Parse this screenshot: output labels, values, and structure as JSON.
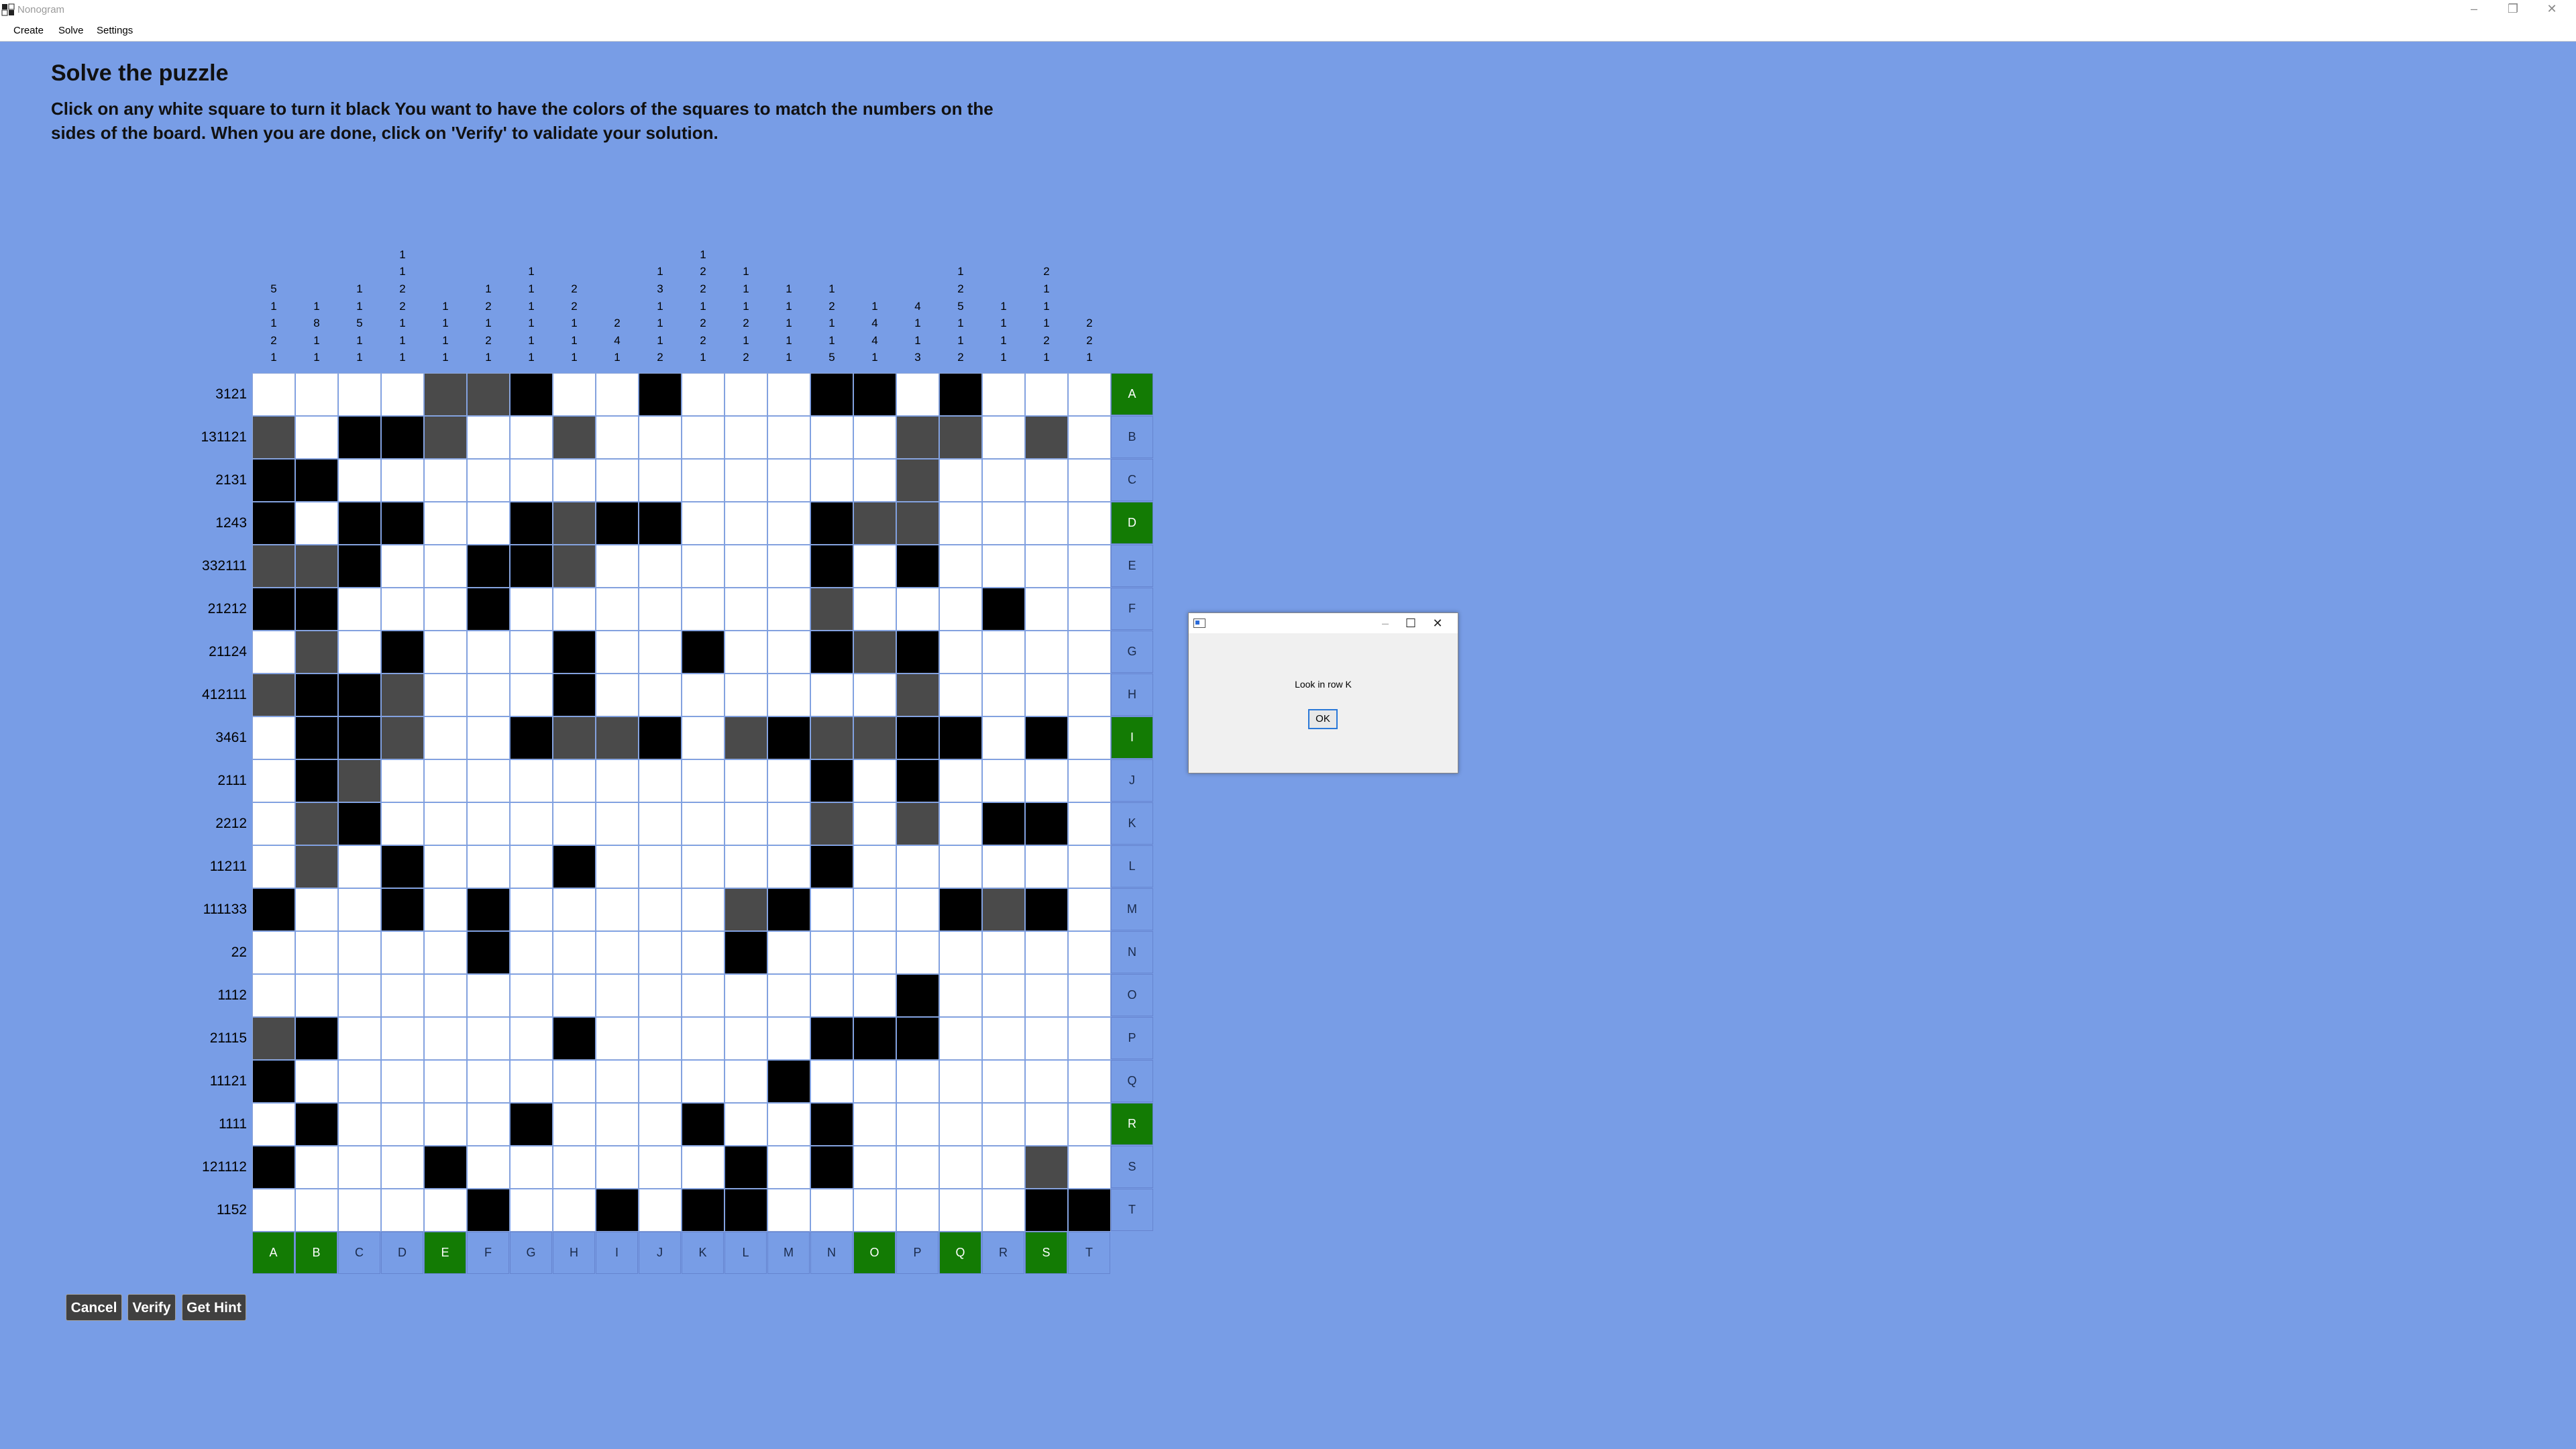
{
  "window": {
    "title": "Nonogram",
    "minimize_glyph": "–",
    "restore_glyph": "❐",
    "close_glyph": "✕"
  },
  "menu": [
    "Create",
    "Solve",
    "Settings"
  ],
  "heading": "Solve the puzzle",
  "instructions": "Click on any white square to turn it black You want to have the colors of the squares to match the numbers on the sides of the board. When you are done, click on 'Verify' to validate your solution.",
  "column_clues": [
    [
      "5",
      "1",
      "1",
      "2",
      "1"
    ],
    [
      "1",
      "8",
      "1",
      "1"
    ],
    [
      "1",
      "1",
      "5",
      "1",
      "1"
    ],
    [
      "1",
      "1",
      "2",
      "2",
      "1",
      "1",
      "1"
    ],
    [
      "1",
      "1",
      "1",
      "1"
    ],
    [
      "1",
      "2",
      "1",
      "2",
      "1"
    ],
    [
      "1",
      "1",
      "1",
      "1",
      "1",
      "1"
    ],
    [
      "2",
      "2",
      "1",
      "1",
      "1"
    ],
    [
      "2",
      "4",
      "1"
    ],
    [
      "1",
      "3",
      "1",
      "1",
      "1",
      "2"
    ],
    [
      "1",
      "2",
      "2",
      "1",
      "2",
      "2",
      "1"
    ],
    [
      "1",
      "1",
      "1",
      "2",
      "1",
      "2"
    ],
    [
      "1",
      "1",
      "1",
      "1",
      "1"
    ],
    [
      "1",
      "2",
      "1",
      "1",
      "5"
    ],
    [
      "1",
      "4",
      "4",
      "1"
    ],
    [
      "4",
      "1",
      "1",
      "3"
    ],
    [
      "1",
      "2",
      "5",
      "1",
      "1",
      "2"
    ],
    [
      "1",
      "1",
      "1",
      "1"
    ],
    [
      "2",
      "1",
      "1",
      "1",
      "2",
      "1"
    ],
    [
      "2",
      "2",
      "1"
    ]
  ],
  "row_clues": [
    "3121",
    "131121",
    "2131",
    "1243",
    "332111",
    "21212",
    "21124",
    "412111",
    "3461",
    "2111",
    "2212",
    "11211",
    "111133",
    "22",
    "1112",
    "21115",
    "11121",
    "1111",
    "121112",
    "1152"
  ],
  "letters": [
    "A",
    "B",
    "C",
    "D",
    "E",
    "F",
    "G",
    "H",
    "I",
    "J",
    "K",
    "L",
    "M",
    "N",
    "O",
    "P",
    "Q",
    "R",
    "S",
    "T"
  ],
  "highlighted_rows": [
    "A",
    "D",
    "I",
    "R"
  ],
  "highlighted_columns": [
    "A",
    "B",
    "E",
    "O",
    "Q",
    "S"
  ],
  "grid": [
    "....GGB..B...BB.B.",
    "G.BBG..G.......GG.G",
    "BB.............G...",
    "B.BB..BGBB...BGG...",
    "GGB..BBG.....B.B...",
    "BB...B.......G...B.",
    ".G.B...B..B..BGB...",
    "GBBG...B.......G...",
    ".BBG..BGGB.GBGGBB.B.",
    ".BG..........B.B...",
    ".GB..........G.G.BB",
    ".G.B...B.....B.....",
    "B..B.B.....GB...BGB.",
    ".....B.....B........",
    "...............B....",
    "GB.....B.....BBB....",
    "B...........B.......",
    ".B....B...B..B......",
    "B...B......B.B....G.",
    ".....B..B.BB......BB"
  ],
  "buttons": {
    "cancel": "Cancel",
    "verify": "Verify",
    "hint": "Get Hint"
  },
  "dialog": {
    "message": "Look in row K",
    "ok": "OK",
    "minimize_glyph": "–",
    "maximize_glyph": "☐",
    "close_glyph": "✕"
  },
  "colors": {
    "background": "#789de6",
    "filled": "#000000",
    "marked": "#4a4a4a",
    "highlight": "#137b04"
  }
}
